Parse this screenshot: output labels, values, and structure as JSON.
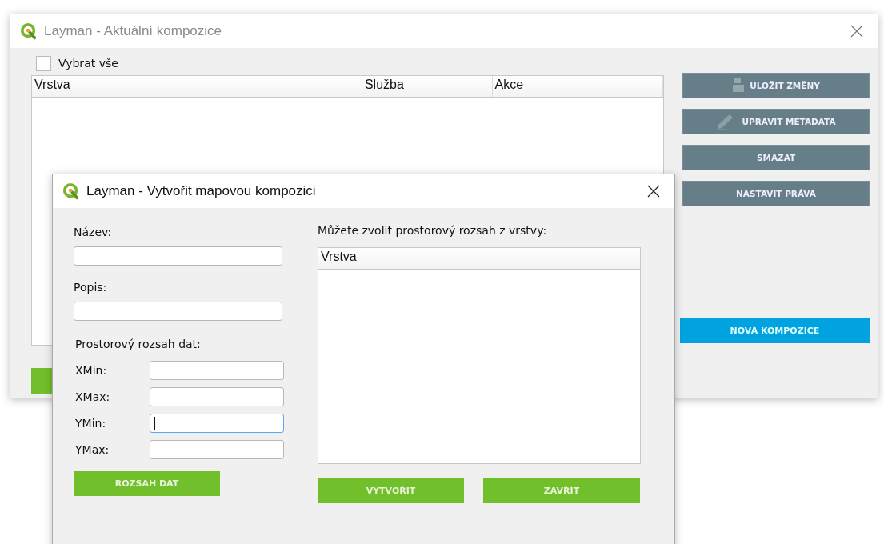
{
  "main_window": {
    "title": "Layman - Aktuální kompozice",
    "active": false,
    "select_all": {
      "label": "Vybrat vše",
      "checked": false
    },
    "table": {
      "columns": [
        "Vrstva",
        "Služba",
        "Akce"
      ]
    },
    "buttons": [
      {
        "label": "ULOŽIT ZMĚNY",
        "kind": "save"
      },
      {
        "label": "UPRAVIT METADATA",
        "kind": "edit"
      },
      {
        "label": "SMAZAT",
        "kind": "plain"
      },
      {
        "label": "NASTAVIT PRÁVA",
        "kind": "plain"
      }
    ],
    "new_button": "NOVÁ KOMPOZICE"
  },
  "dialog": {
    "title": "Layman - Vytvořit mapovou kompozici",
    "active": true,
    "name_label": "Název:",
    "name_field": {
      "focused": false
    },
    "description_label": "Popis:",
    "description_field": {
      "focused": false
    },
    "extent_label": "Prostorový rozsah dat:",
    "extent_fields": [
      {
        "label": "XMin:",
        "focused": false
      },
      {
        "label": "XMax:",
        "focused": false
      },
      {
        "label": "YMin:",
        "focused": true
      },
      {
        "label": "YMax:",
        "focused": false
      }
    ],
    "extent_button": "ROZSAH DAT",
    "layer_hint": "Můžete zvolit prostorový rozsah z vrstvy:",
    "layer_table": {
      "columns": [
        "Vrstva"
      ]
    },
    "buttons": [
      "VYTVOŘIT",
      "ZAVŘÍT"
    ]
  }
}
